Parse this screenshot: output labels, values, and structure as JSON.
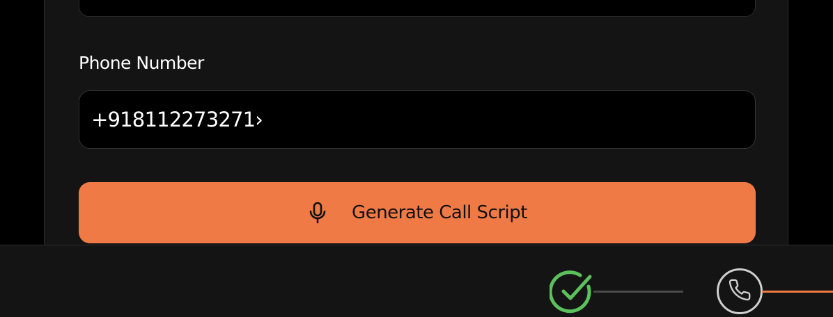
{
  "form": {
    "phone_label": "Phone Number",
    "phone_value": "+918112273271›"
  },
  "actions": {
    "generate_label": "Generate Call Script",
    "generate_icon": "microphone-icon",
    "accent_color": "#f07a45"
  },
  "stepper": {
    "steps": [
      {
        "icon": "check-circle-icon",
        "status": "complete",
        "color": "#5cc05c"
      },
      {
        "icon": "phone-icon",
        "status": "current",
        "color": "#cfcfcf"
      }
    ]
  }
}
